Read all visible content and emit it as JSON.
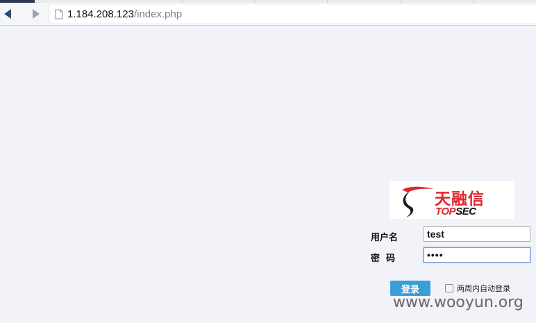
{
  "browser": {
    "url_host": "1.184.208.123",
    "url_path": "/index.php",
    "back_icon": "back-arrow-icon",
    "forward_icon": "forward-arrow-icon",
    "page_icon": "page-icon"
  },
  "logo": {
    "cn_text": "天融信",
    "en_top": "TOP",
    "en_sec": "SEC"
  },
  "login": {
    "username_label": "用户名",
    "password_label": "密  码",
    "username_value": "test",
    "password_value": "••••",
    "submit_label": "登录",
    "remember_label": "两周内自动登录",
    "remember_checked": false
  },
  "watermark": "www.wooyun.org",
  "colors": {
    "brand_red": "#e0262d",
    "button_blue": "#3c9ed6"
  }
}
